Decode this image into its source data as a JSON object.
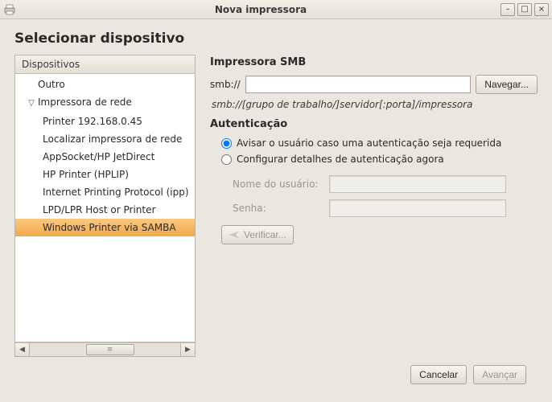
{
  "window": {
    "title": "Nova impressora"
  },
  "page": {
    "heading": "Selecionar dispositivo"
  },
  "tree": {
    "header": "Dispositivos",
    "items": {
      "outro": "Outro",
      "impressora_rede": "Impressora de rede",
      "printer_ip": "Printer 192.168.0.45",
      "localizar": "Localizar impressora de rede",
      "appsocket": "AppSocket/HP JetDirect",
      "hplip": "HP Printer (HPLIP)",
      "ipp": "Internet Printing Protocol (ipp)",
      "lpd": "LPD/LPR Host or Printer",
      "samba": "Windows Printer via SAMBA"
    }
  },
  "smb": {
    "title": "Impressora SMB",
    "prefix": "smb://",
    "url": "",
    "browse": "Navegar...",
    "hint": "smb://[grupo de trabalho/]servidor[:porta]/impressora"
  },
  "auth": {
    "title": "Autenticação",
    "radio_prompt": "Avisar o usuário caso uma autenticação seja requerida",
    "radio_now": "Configurar detalhes de autenticação agora",
    "username_label": "Nome do usuário:",
    "password_label": "Senha:",
    "username": "",
    "password": "",
    "verify": "Verificar..."
  },
  "footer": {
    "cancel": "Cancelar",
    "forward": "Avançar"
  }
}
